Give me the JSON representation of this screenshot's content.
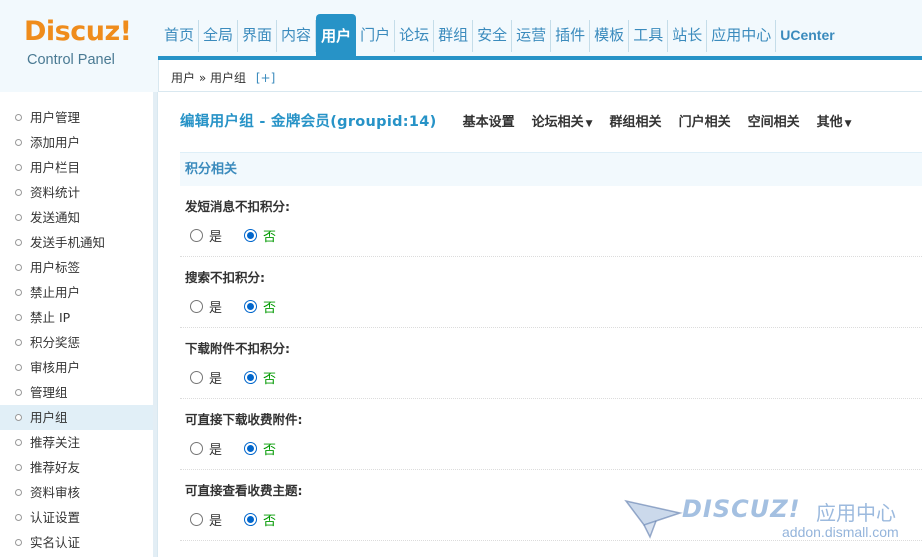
{
  "logo": {
    "brand": "Discuz!",
    "subtitle": "Control Panel"
  },
  "topnav": [
    "首页",
    "全局",
    "界面",
    "内容",
    "用户",
    "门户",
    "论坛",
    "群组",
    "安全",
    "运营",
    "插件",
    "模板",
    "工具",
    "站长",
    "应用中心",
    "UCenter"
  ],
  "topnav_active": "用户",
  "breadcrumb": {
    "section": "用户",
    "sep": "»",
    "page": "用户组",
    "add": "[+]"
  },
  "sidebar": {
    "items": [
      "用户管理",
      "添加用户",
      "用户栏目",
      "资料统计",
      "发送通知",
      "发送手机通知",
      "用户标签",
      "禁止用户",
      "禁止 IP",
      "积分奖惩",
      "审核用户",
      "管理组",
      "用户组",
      "推荐关注",
      "推荐好友",
      "资料审核",
      "认证设置",
      "实名认证"
    ],
    "active": "用户组"
  },
  "main": {
    "title": "编辑用户组 - 金牌会员(groupid:14)",
    "tabs": [
      {
        "label": "基本设置",
        "dropdown": false
      },
      {
        "label": "论坛相关",
        "dropdown": true
      },
      {
        "label": "群组相关",
        "dropdown": false
      },
      {
        "label": "门户相关",
        "dropdown": false
      },
      {
        "label": "空间相关",
        "dropdown": false
      },
      {
        "label": "其他",
        "dropdown": true
      }
    ],
    "section": "积分相关",
    "settings": [
      {
        "label": "发短消息不扣积分:",
        "yes": "是",
        "no": "否",
        "value": "否"
      },
      {
        "label": "搜索不扣积分:",
        "yes": "是",
        "no": "否",
        "value": "否"
      },
      {
        "label": "下载附件不扣积分:",
        "yes": "是",
        "no": "否",
        "value": "否"
      },
      {
        "label": "可直接下载收费附件:",
        "yes": "是",
        "no": "否",
        "value": "否"
      },
      {
        "label": "可直接查看收费主题:",
        "yes": "是",
        "no": "否",
        "value": "否"
      }
    ]
  },
  "watermark": {
    "brand": "DISCUZ!",
    "cn": "应用中心",
    "url": "addon.dismall.com"
  },
  "colors": {
    "accent": "#2793c7",
    "logo": "#ef8c1c",
    "selected_option": "#009900"
  }
}
